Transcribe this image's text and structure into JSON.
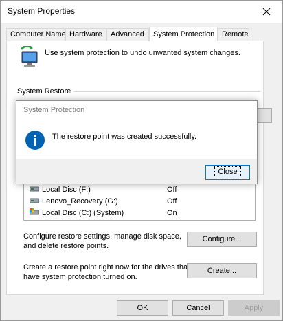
{
  "window": {
    "title": "System Properties"
  },
  "tabs": [
    {
      "label": "Computer Name"
    },
    {
      "label": "Hardware"
    },
    {
      "label": "Advanced"
    },
    {
      "label": "System Protection",
      "active": true
    },
    {
      "label": "Remote"
    }
  ],
  "panel": {
    "intro_text": "Use system protection to undo unwanted system changes.",
    "system_restore_label": "System Restore"
  },
  "drives": [
    {
      "name": "Local Disc (F:)",
      "status": "Off"
    },
    {
      "name": "Lenovo_Recovery (G:)",
      "status": "Off"
    },
    {
      "name": "Local Disc (C:) (System)",
      "status": "On"
    }
  ],
  "configure": {
    "text_line1": "Configure restore settings, manage disk space,",
    "text_line2": "and delete restore points.",
    "button_label": "Configure..."
  },
  "create": {
    "text_line1": "Create a restore point right now for the drives that",
    "text_line2": "have system protection turned on.",
    "button_label": "Create..."
  },
  "footer": {
    "ok_label": "OK",
    "cancel_label": "Cancel",
    "apply_label": "Apply"
  },
  "dialog": {
    "title": "System Protection",
    "message": "The restore point was created successfully.",
    "close_label": "Close",
    "info_icon": "info-icon"
  },
  "colors": {
    "accent": "#0078d7",
    "info_blue": "#0063b1"
  }
}
